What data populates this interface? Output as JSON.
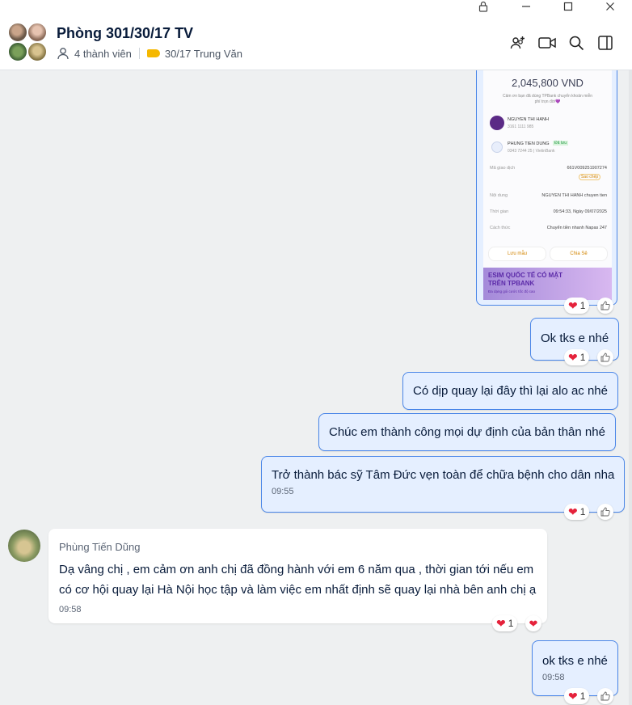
{
  "window": {
    "lock_icon": "lock-icon",
    "minimize_glyph": "—",
    "maximize_glyph": "☐",
    "close_glyph": "✕"
  },
  "header": {
    "title": "Phòng 301/30/17 TV",
    "members": "4 thành viên",
    "tag": "30/17 Trung Văn",
    "tag_color": "#f5b800"
  },
  "receipt": {
    "amount": "2,045,800 VND",
    "note": "Cảm ơn bạn đã dùng TPBank chuyển khoản miễn phí trọn đời💜",
    "sender_name": "NGUYEN THI HANH",
    "sender_account": "3161 1111 985",
    "receiver_name": "PHUNG TIEN DUNG",
    "receiver_badge": "Đã lưu",
    "receiver_account": "0343 7244 25 | VietinBank",
    "txn_label": "Mã giao dịch",
    "txn_value": "661V009251907274",
    "copy_label": "Sao chép",
    "content_label": "Nội dung",
    "content_value": "NGUYEN THI HANH chuyen tien",
    "time_label": "Thời gian",
    "time_value": "09:54:33, Ngày 09/07/2025",
    "method_label": "Cách thức",
    "method_value": "Chuyển tiền nhanh Napas 247",
    "save_btn": "Lưu mẫu",
    "share_btn": "Chia Sẻ",
    "banner_title": "ESIM QUỐC TẾ CÓ MẶT TRÊN TPBANK",
    "banner_sub": "Đa dạng gói cước tốc độ cao"
  },
  "messages": [
    {
      "text": "Ok tks e nhé",
      "reaction_count": "1"
    },
    {
      "text": "Có dịp quay lại đây thì lại alo ac nhé"
    },
    {
      "text": "Chúc em thành công mọi dự định của bản thân nhé"
    },
    {
      "text": "Trở thành bác sỹ Tâm Đức vẹn toàn để chữa bệnh cho dân nha",
      "time": "09:55",
      "reaction_count": "1"
    },
    {
      "sender": "Phùng Tiến Dũng",
      "line1": "Dạ vâng chị , em cảm ơn anh chị đã đồng hành với em 6 năm qua , thời gian tới nếu em",
      "line2": "có cơ hội quay lại Hà Nội học tập và làm việc em nhất định sẽ quay lại nhà bên anh chị ạ",
      "time": "09:58",
      "reaction_count": "1"
    },
    {
      "text": "ok tks e nhé",
      "time": "09:58",
      "reaction_count": "1"
    }
  ],
  "receipt_reaction_count": "1",
  "colors": {
    "outgoing_bubble": "#e5efff",
    "outgoing_border": "#4a86e8",
    "incoming_bubble": "#ffffff",
    "heart": "#e5223b"
  }
}
